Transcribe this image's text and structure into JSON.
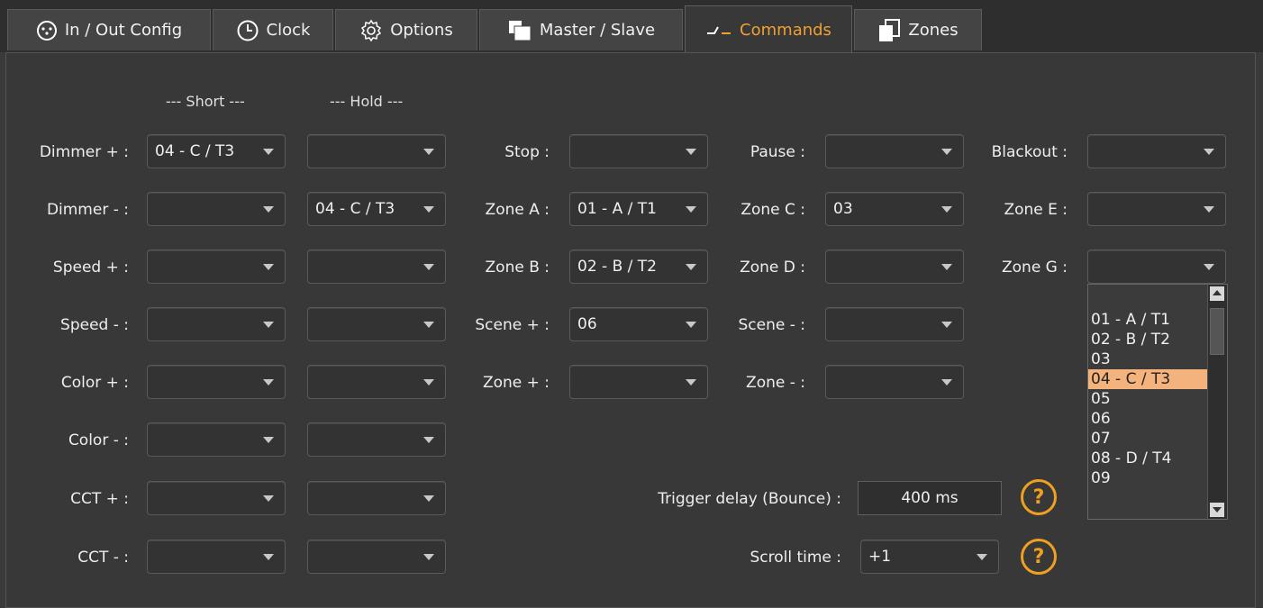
{
  "tabs": [
    {
      "label": "In / Out Config",
      "icon": "xlr-connector-icon"
    },
    {
      "label": "Clock",
      "icon": "clock-icon"
    },
    {
      "label": "Options",
      "icon": "gear-icon"
    },
    {
      "label": "Master / Slave",
      "icon": "master-slave-icon"
    },
    {
      "label": "Commands",
      "icon": "commands-icon",
      "active": true
    },
    {
      "label": "Zones",
      "icon": "zones-icon"
    }
  ],
  "headers": {
    "short": "--- Short ---",
    "hold": "--- Hold ---"
  },
  "left_rows": [
    {
      "label": "Dimmer + :",
      "short": "04 - C / T3",
      "hold": ""
    },
    {
      "label": "Dimmer - :",
      "short": "",
      "hold": "04 - C / T3"
    },
    {
      "label": "Speed + :",
      "short": "",
      "hold": ""
    },
    {
      "label": "Speed - :",
      "short": "",
      "hold": ""
    },
    {
      "label": "Color + :",
      "short": "",
      "hold": ""
    },
    {
      "label": "Color - :",
      "short": "",
      "hold": ""
    },
    {
      "label": "CCT + :",
      "short": "",
      "hold": ""
    },
    {
      "label": "CCT - :",
      "short": "",
      "hold": ""
    }
  ],
  "col3": [
    {
      "label": "Stop :",
      "value": ""
    },
    {
      "label": "Zone A :",
      "value": "01 - A / T1"
    },
    {
      "label": "Zone B :",
      "value": "02 - B / T2"
    },
    {
      "label": "Scene + :",
      "value": "06"
    },
    {
      "label": "Zone + :",
      "value": ""
    }
  ],
  "col4": [
    {
      "label": "Pause :",
      "value": ""
    },
    {
      "label": "Zone C :",
      "value": "03"
    },
    {
      "label": "Zone D :",
      "value": ""
    },
    {
      "label": "Scene - :",
      "value": ""
    },
    {
      "label": "Zone - :",
      "value": ""
    }
  ],
  "col5": [
    {
      "label": "Blackout :",
      "value": ""
    },
    {
      "label": "Zone E :",
      "value": ""
    },
    {
      "label": "Zone G :",
      "value": ""
    }
  ],
  "trigger_delay": {
    "label": "Trigger delay (Bounce) :",
    "value": "400 ms"
  },
  "scroll_time": {
    "label": "Scroll time :",
    "value": "+1"
  },
  "help_glyph": "?",
  "dropdown_options": [
    "01 - A / T1",
    "02 - B / T2",
    "03",
    "04 - C / T3",
    "05",
    "06",
    "07",
    "08 - D / T4",
    "09"
  ],
  "dropdown_selected": "04 - C / T3",
  "colors": {
    "accent": "#f0a020",
    "selected_bg": "#f4b37c",
    "panel": "#383838"
  }
}
